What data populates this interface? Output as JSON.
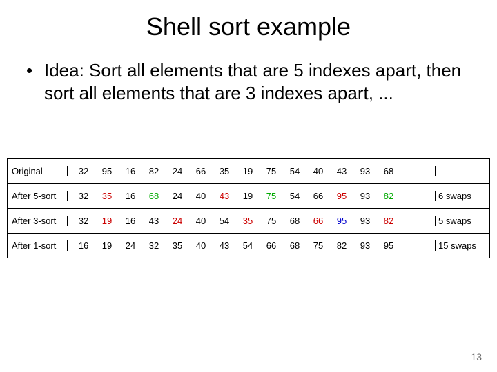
{
  "title": "Shell sort example",
  "bullet": "Idea: Sort all elements that are 5 indexes apart, then sort all elements that are 3 indexes apart, ...",
  "page_num": "13",
  "rows": [
    {
      "label": "Original",
      "nums": [
        {
          "v": "32",
          "c": "blk"
        },
        {
          "v": "95",
          "c": "blk"
        },
        {
          "v": "16",
          "c": "blk"
        },
        {
          "v": "82",
          "c": "blk"
        },
        {
          "v": "24",
          "c": "blk"
        },
        {
          "v": "66",
          "c": "blk"
        },
        {
          "v": "35",
          "c": "blk"
        },
        {
          "v": "19",
          "c": "blk"
        },
        {
          "v": "75",
          "c": "blk"
        },
        {
          "v": "54",
          "c": "blk"
        },
        {
          "v": "40",
          "c": "blk"
        },
        {
          "v": "43",
          "c": "blk"
        },
        {
          "v": "93",
          "c": "blk"
        },
        {
          "v": "68",
          "c": "blk"
        }
      ],
      "swaps": ""
    },
    {
      "label": "After 5-sort",
      "nums": [
        {
          "v": "32",
          "c": "blk"
        },
        {
          "v": "35",
          "c": "red"
        },
        {
          "v": "16",
          "c": "blk"
        },
        {
          "v": "68",
          "c": "grn"
        },
        {
          "v": "24",
          "c": "blk"
        },
        {
          "v": "40",
          "c": "blk"
        },
        {
          "v": "43",
          "c": "red"
        },
        {
          "v": "19",
          "c": "blk"
        },
        {
          "v": "75",
          "c": "grn"
        },
        {
          "v": "54",
          "c": "blk"
        },
        {
          "v": "66",
          "c": "blk"
        },
        {
          "v": "95",
          "c": "red"
        },
        {
          "v": "93",
          "c": "blk"
        },
        {
          "v": "82",
          "c": "grn"
        }
      ],
      "swaps": "6 swaps"
    },
    {
      "label": "After 3-sort",
      "nums": [
        {
          "v": "32",
          "c": "blk"
        },
        {
          "v": "19",
          "c": "red"
        },
        {
          "v": "16",
          "c": "blk"
        },
        {
          "v": "43",
          "c": "blk"
        },
        {
          "v": "24",
          "c": "red"
        },
        {
          "v": "40",
          "c": "blk"
        },
        {
          "v": "54",
          "c": "blk"
        },
        {
          "v": "35",
          "c": "red"
        },
        {
          "v": "75",
          "c": "blk"
        },
        {
          "v": "68",
          "c": "blk"
        },
        {
          "v": "66",
          "c": "red"
        },
        {
          "v": "95",
          "c": "blu"
        },
        {
          "v": "93",
          "c": "blk"
        },
        {
          "v": "82",
          "c": "red"
        }
      ],
      "swaps": "5 swaps"
    },
    {
      "label": "After 1-sort",
      "nums": [
        {
          "v": "16",
          "c": "blk"
        },
        {
          "v": "19",
          "c": "blk"
        },
        {
          "v": "24",
          "c": "blk"
        },
        {
          "v": "32",
          "c": "blk"
        },
        {
          "v": "35",
          "c": "blk"
        },
        {
          "v": "40",
          "c": "blk"
        },
        {
          "v": "43",
          "c": "blk"
        },
        {
          "v": "54",
          "c": "blk"
        },
        {
          "v": "66",
          "c": "blk"
        },
        {
          "v": "68",
          "c": "blk"
        },
        {
          "v": "75",
          "c": "blk"
        },
        {
          "v": "82",
          "c": "blk"
        },
        {
          "v": "93",
          "c": "blk"
        },
        {
          "v": "95",
          "c": "blk"
        }
      ],
      "swaps": "15 swaps"
    }
  ]
}
